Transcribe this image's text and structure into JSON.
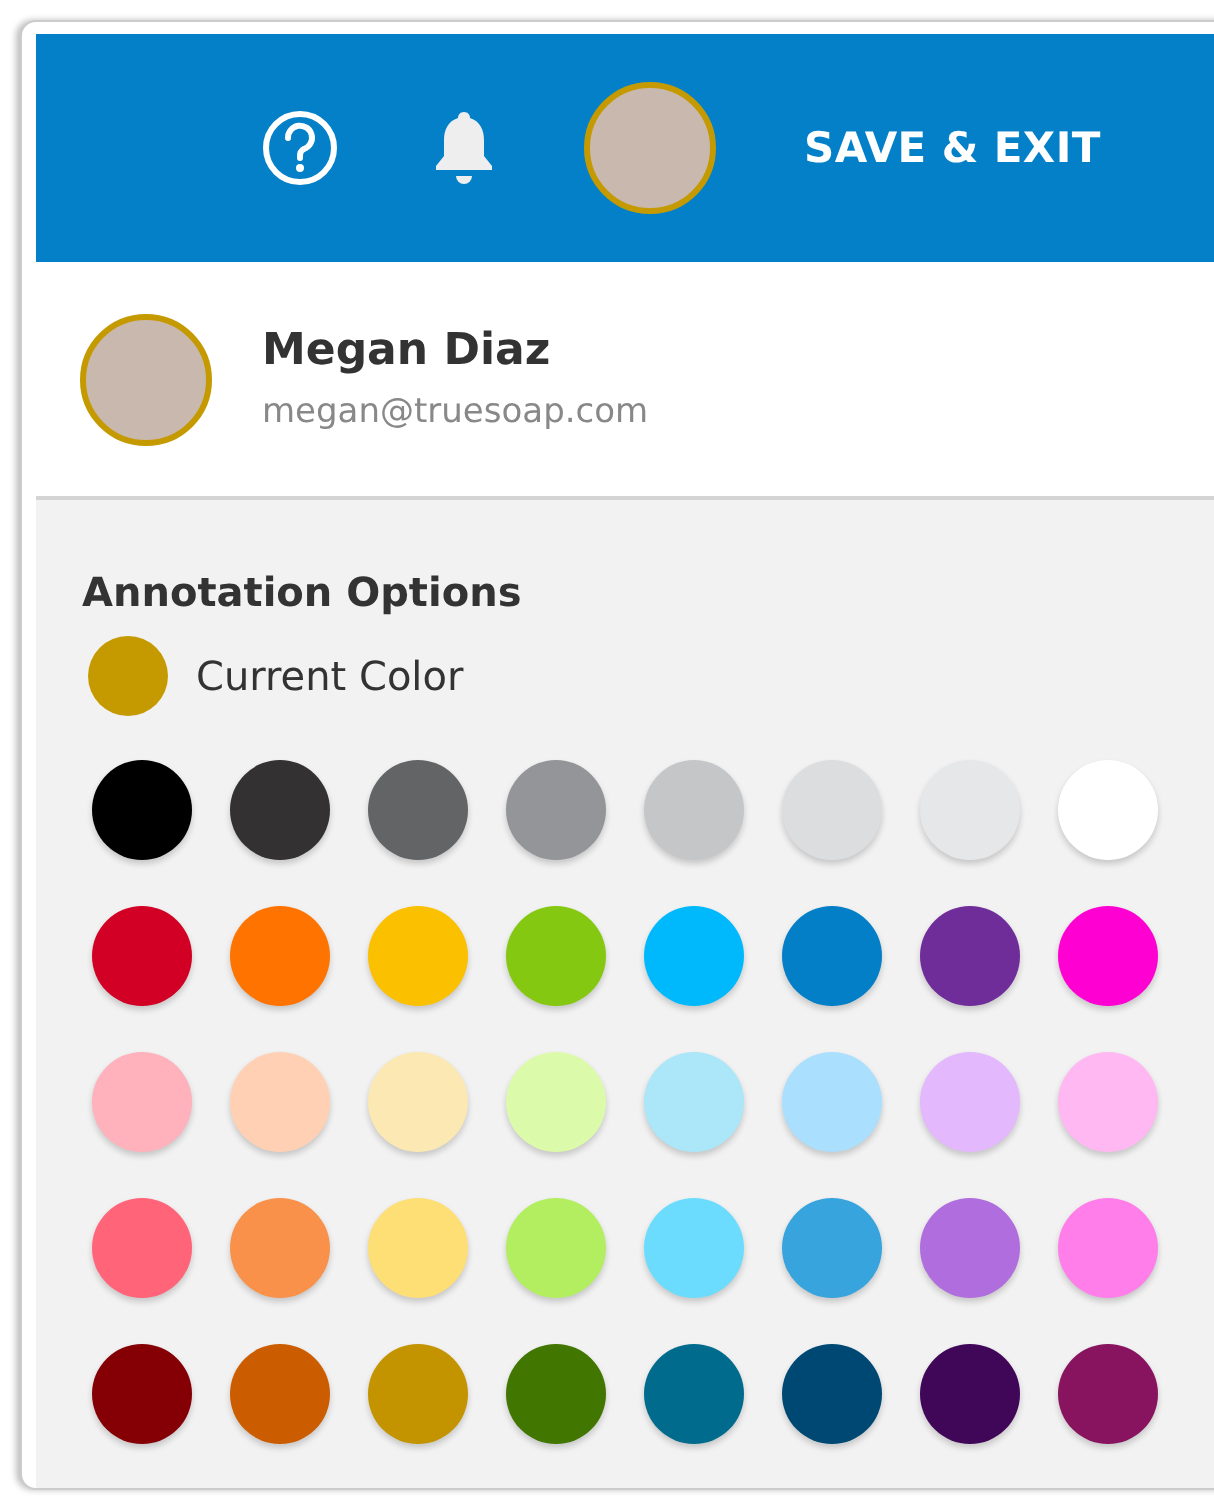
{
  "header": {
    "action": "SAVE & EXIT"
  },
  "user": {
    "name": "Megan Diaz",
    "email": "megan@truesoap.com"
  },
  "annotation": {
    "title": "Annotation Options",
    "current": {
      "label": "Current Color",
      "color": "#c49a00"
    },
    "swatches": [
      [
        {
          "color": "#000000"
        },
        {
          "color": "#333132"
        },
        {
          "color": "#636466"
        },
        {
          "color": "#939598"
        },
        {
          "color": "#c5c6c8"
        },
        {
          "color": "#dcdddf"
        },
        {
          "color": "#e6e7e8"
        },
        {
          "color": "#ffffff"
        }
      ],
      [
        {
          "color": "#d10024"
        },
        {
          "color": "#ff7300"
        },
        {
          "color": "#fbc000"
        },
        {
          "color": "#84c811"
        },
        {
          "color": "#00b9fd"
        },
        {
          "color": "#037fc7"
        },
        {
          "color": "#6f2d99"
        },
        {
          "color": "#ff00d2"
        }
      ],
      [
        {
          "color": "#ffb1bc"
        },
        {
          "color": "#ffd0b3"
        },
        {
          "color": "#fbe8b3"
        },
        {
          "color": "#dcfbaa"
        },
        {
          "color": "#abe6f9"
        },
        {
          "color": "#aadffd"
        },
        {
          "color": "#e3b8fd"
        },
        {
          "color": "#ffb8f2"
        }
      ],
      [
        {
          "color": "#ff6479"
        },
        {
          "color": "#f9914a"
        },
        {
          "color": "#fddf76"
        },
        {
          "color": "#b3ee60"
        },
        {
          "color": "#6bdcfe"
        },
        {
          "color": "#37a4de"
        },
        {
          "color": "#af6ddd"
        },
        {
          "color": "#ff7ee9"
        }
      ],
      [
        {
          "color": "#840005"
        },
        {
          "color": "#cc5c00"
        },
        {
          "color": "#c39400"
        },
        {
          "color": "#417600"
        },
        {
          "color": "#006b8d"
        },
        {
          "color": "#004874"
        },
        {
          "color": "#400658"
        },
        {
          "color": "#88135f"
        }
      ]
    ]
  }
}
